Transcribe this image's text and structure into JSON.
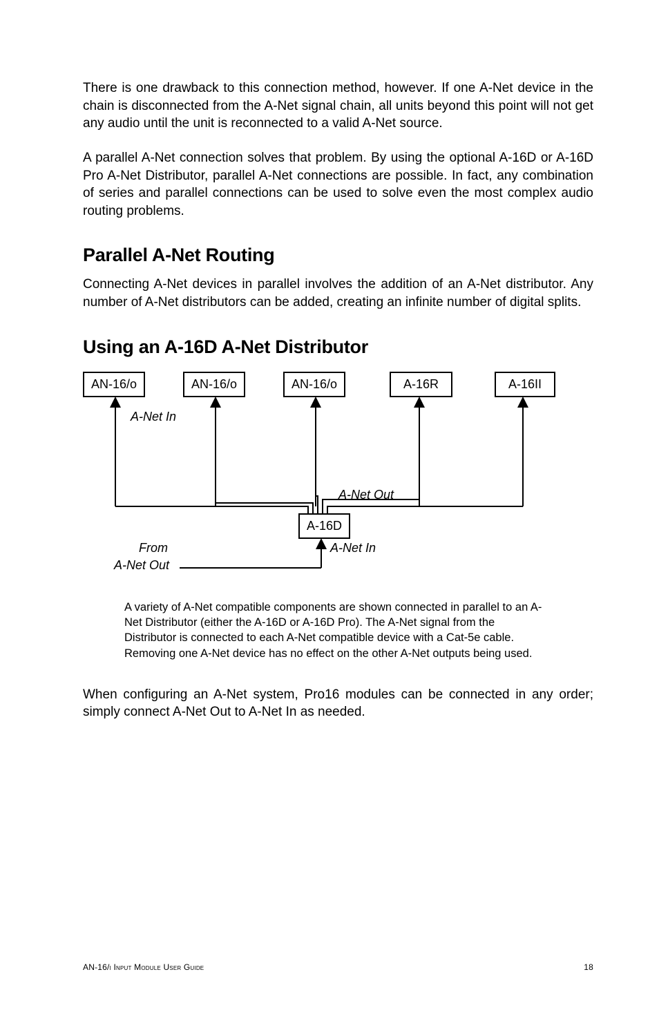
{
  "paragraphs": {
    "p1": "There is one drawback to this connection method, however. If one A-Net device in the chain is disconnected from the A-Net signal chain, all units beyond this point will not get any audio until the unit is reconnected to a valid A-Net source.",
    "p2": "A parallel A-Net connection solves that problem. By using the optional A‑16D or A-16D Pro A-Net Distributor, parallel A-Net connections are possible. In fact, any combination of series and parallel connections can be used to solve even the most complex audio routing problems.",
    "p3": "Connecting A-Net devices in parallel involves the addition of an A-Net distributor. Any number of A-Net distributors can be added, creating an infinite number of digital splits.",
    "p4": "When configuring an A-Net system, Pro16 modules can be connected in any order; simply connect A-Net Out to A-Net In as needed."
  },
  "headings": {
    "h1": "Parallel A-Net Routing",
    "h2": "Using an A-16D A-Net Distributor"
  },
  "diagram": {
    "box1": "AN-16/o",
    "box2": "AN-16/o",
    "box3": "AN-16/o",
    "box4": "A-16R",
    "box5": "A-16II",
    "hub": "A-16D",
    "label_anet_in": "A-Net In",
    "label_anet_out": "A-Net Out",
    "label_anet_in2": "A-Net In",
    "label_from": "From",
    "label_from_anet_out": "A-Net Out"
  },
  "caption": "A variety of A-Net compatible components are shown connected in parallel to an A-Net Distributor (either the A-16D or A-16D Pro). The A-Net signal from the Distributor is connected to each A-Net compatible device with a Cat-5e cable. Removing one A-Net device has no effect on the other A-Net outputs being used.",
  "footer": {
    "left": "AN-16/i Input Module User Guide",
    "right": "18"
  }
}
